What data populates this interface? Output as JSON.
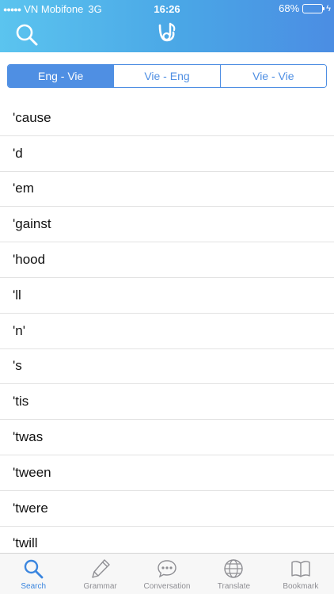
{
  "status_bar": {
    "signal": "●●●●●",
    "carrier": "VN Mobifone",
    "network": "3G",
    "time": "16:26",
    "battery_percent": "68%",
    "battery_level": 0.68
  },
  "header": {
    "search_icon": "search-icon",
    "logo_icon": "app-logo-icon"
  },
  "segments": [
    {
      "label": "Eng - Vie",
      "active": true
    },
    {
      "label": "Vie - Eng",
      "active": false
    },
    {
      "label": "Vie - Vie",
      "active": false
    }
  ],
  "words": [
    "'cause",
    "'d",
    "'em",
    "'gainst",
    "'hood",
    "'ll",
    "'n'",
    "'s",
    "'tis",
    "'twas",
    "'tween",
    "'twere",
    "'twill"
  ],
  "tabs": [
    {
      "label": "Search",
      "icon": "search-icon",
      "active": true
    },
    {
      "label": "Grammar",
      "icon": "pencil-icon",
      "active": false
    },
    {
      "label": "Conversation",
      "icon": "chat-bubble-icon",
      "active": false
    },
    {
      "label": "Translate",
      "icon": "globe-icon",
      "active": false
    },
    {
      "label": "Bookmark",
      "icon": "book-icon",
      "active": false
    }
  ],
  "colors": {
    "accent": "#4f8fe3",
    "header_start": "#5bc4ef",
    "header_end": "#4b8de3",
    "tab_active": "#3b86df",
    "tab_inactive": "#8e8e93"
  }
}
